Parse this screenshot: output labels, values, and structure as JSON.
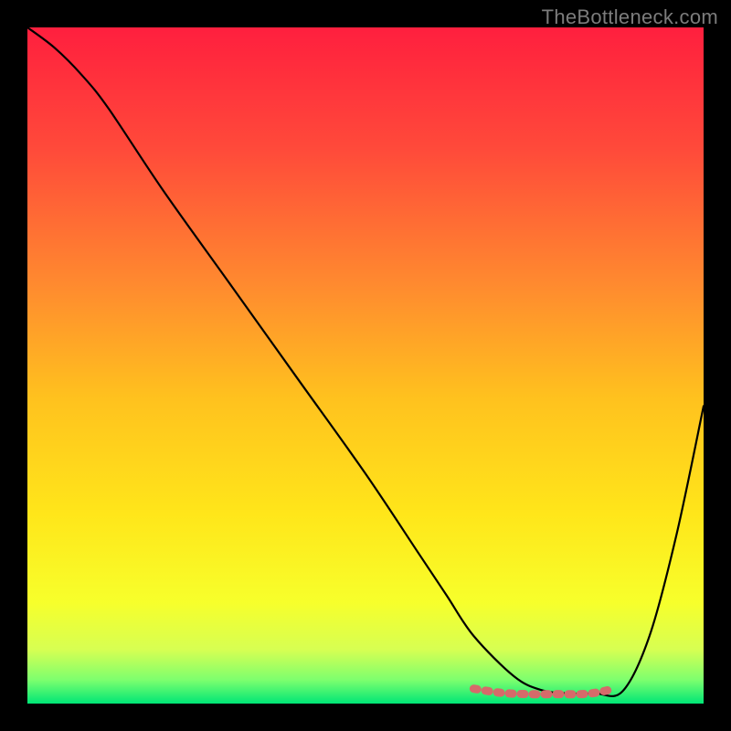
{
  "watermark": "TheBottleneck.com",
  "chart_data": {
    "type": "line",
    "title": "",
    "xlabel": "",
    "ylabel": "",
    "xlim": [
      0,
      100
    ],
    "ylim": [
      0,
      100
    ],
    "gradient_stops": [
      {
        "offset": 0,
        "color": "#ff1f3e"
      },
      {
        "offset": 0.18,
        "color": "#ff4a3a"
      },
      {
        "offset": 0.38,
        "color": "#ff8a2f"
      },
      {
        "offset": 0.55,
        "color": "#ffc21e"
      },
      {
        "offset": 0.72,
        "color": "#ffe61a"
      },
      {
        "offset": 0.85,
        "color": "#f7ff2b"
      },
      {
        "offset": 0.92,
        "color": "#d7ff52"
      },
      {
        "offset": 0.965,
        "color": "#7dff6e"
      },
      {
        "offset": 1.0,
        "color": "#00e676"
      }
    ],
    "series": [
      {
        "name": "bottleneck-curve",
        "color": "#000000",
        "x": [
          0,
          4,
          8,
          12,
          20,
          30,
          40,
          50,
          58,
          62,
          66,
          72,
          76,
          80,
          84,
          88,
          92,
          96,
          100
        ],
        "y": [
          100,
          97,
          93,
          88,
          76,
          62,
          48,
          34,
          22,
          16,
          10,
          4,
          2,
          1.5,
          1.5,
          1.8,
          10,
          25,
          44
        ]
      },
      {
        "name": "optimum-band",
        "color": "#d66a6a",
        "x": [
          66,
          70,
          74,
          78,
          82,
          84,
          86
        ],
        "y": [
          2.2,
          1.6,
          1.4,
          1.4,
          1.4,
          1.6,
          2.0
        ]
      }
    ]
  }
}
